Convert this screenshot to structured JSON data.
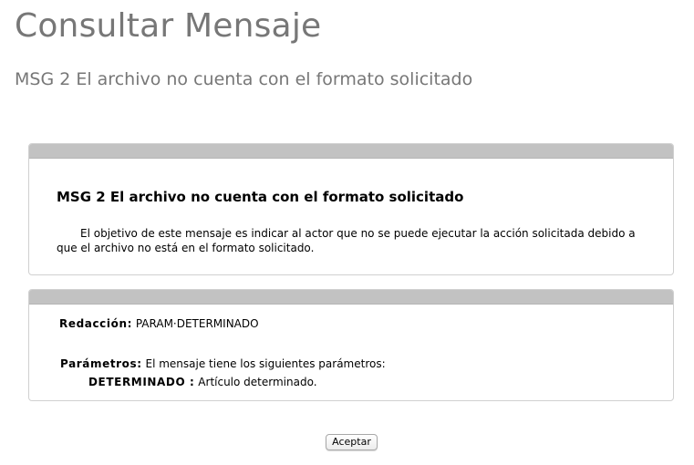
{
  "page": {
    "title": "Consultar Mensaje",
    "subtitle": "MSG 2 El archivo no cuenta con el formato solicitado"
  },
  "description_panel": {
    "heading": "MSG 2 El archivo no cuenta con el formato solicitado",
    "body": "El objetivo de este mensaje es indicar al actor que no se puede ejecutar la acción solicitada debido a que el archivo no está en el formato solicitado."
  },
  "details_panel": {
    "redaccion_label": "Redacción:",
    "redaccion_value": "PARAM·DETERMINADO",
    "parametros_label": "Parámetros:",
    "parametros_value": "El mensaje tiene los siguientes parámetros:",
    "params": [
      {
        "name": "DETERMINADO :",
        "description": "Artículo determinado."
      }
    ]
  },
  "actions": {
    "accept_label": "Aceptar"
  }
}
